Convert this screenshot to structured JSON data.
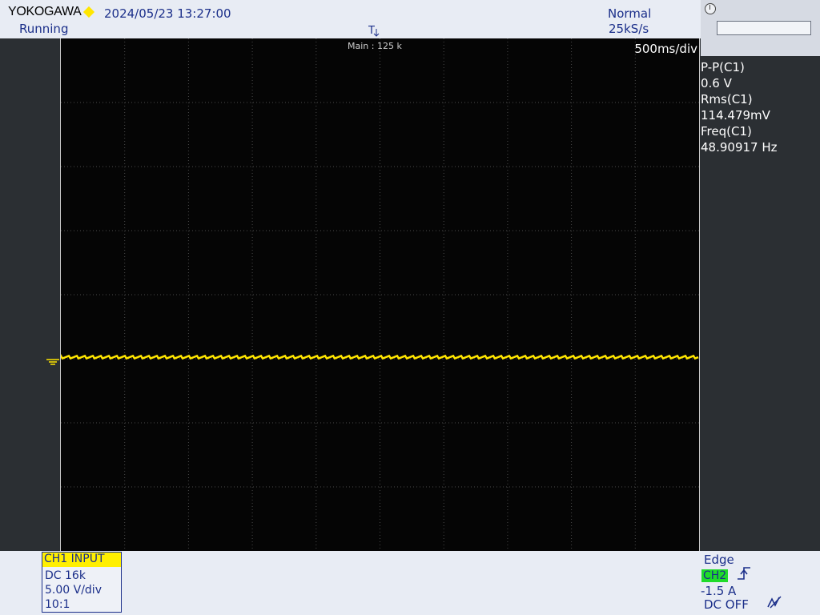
{
  "header": {
    "brand": "YOKOGAWA",
    "datetime": "2024/05/23 13:27:00",
    "status": "Running",
    "acq_mode": "Normal",
    "sample_rate": "25kS/s",
    "trigger_position_symbol": "T"
  },
  "display": {
    "zoom_label": "Main : 125 k",
    "time_div": "500ms/div",
    "trace_color": "#ffe600",
    "grid_color": "#4a4a4a"
  },
  "measurements": [
    {
      "name": "P-P(C1)",
      "value": " 0.6 V"
    },
    {
      "name": "Rms(C1)",
      "value": " 114.479mV"
    },
    {
      "name": "Freq(C1)",
      "value": " 48.90917 Hz"
    }
  ],
  "channel1": {
    "header": "CH1  INPUT",
    "coupling": "DC 16k",
    "scale": "5.00 V/div",
    "probe": "10:1",
    "color": "#ffef00"
  },
  "trigger": {
    "type": "Edge",
    "source": "CH2",
    "level": "-1.5 A",
    "coupling": "DC OFF",
    "source_color": "#1fdb2a",
    "slope_icon": "rising-edge-icon",
    "hf_reject_icon": "hf-reject-icon"
  }
}
